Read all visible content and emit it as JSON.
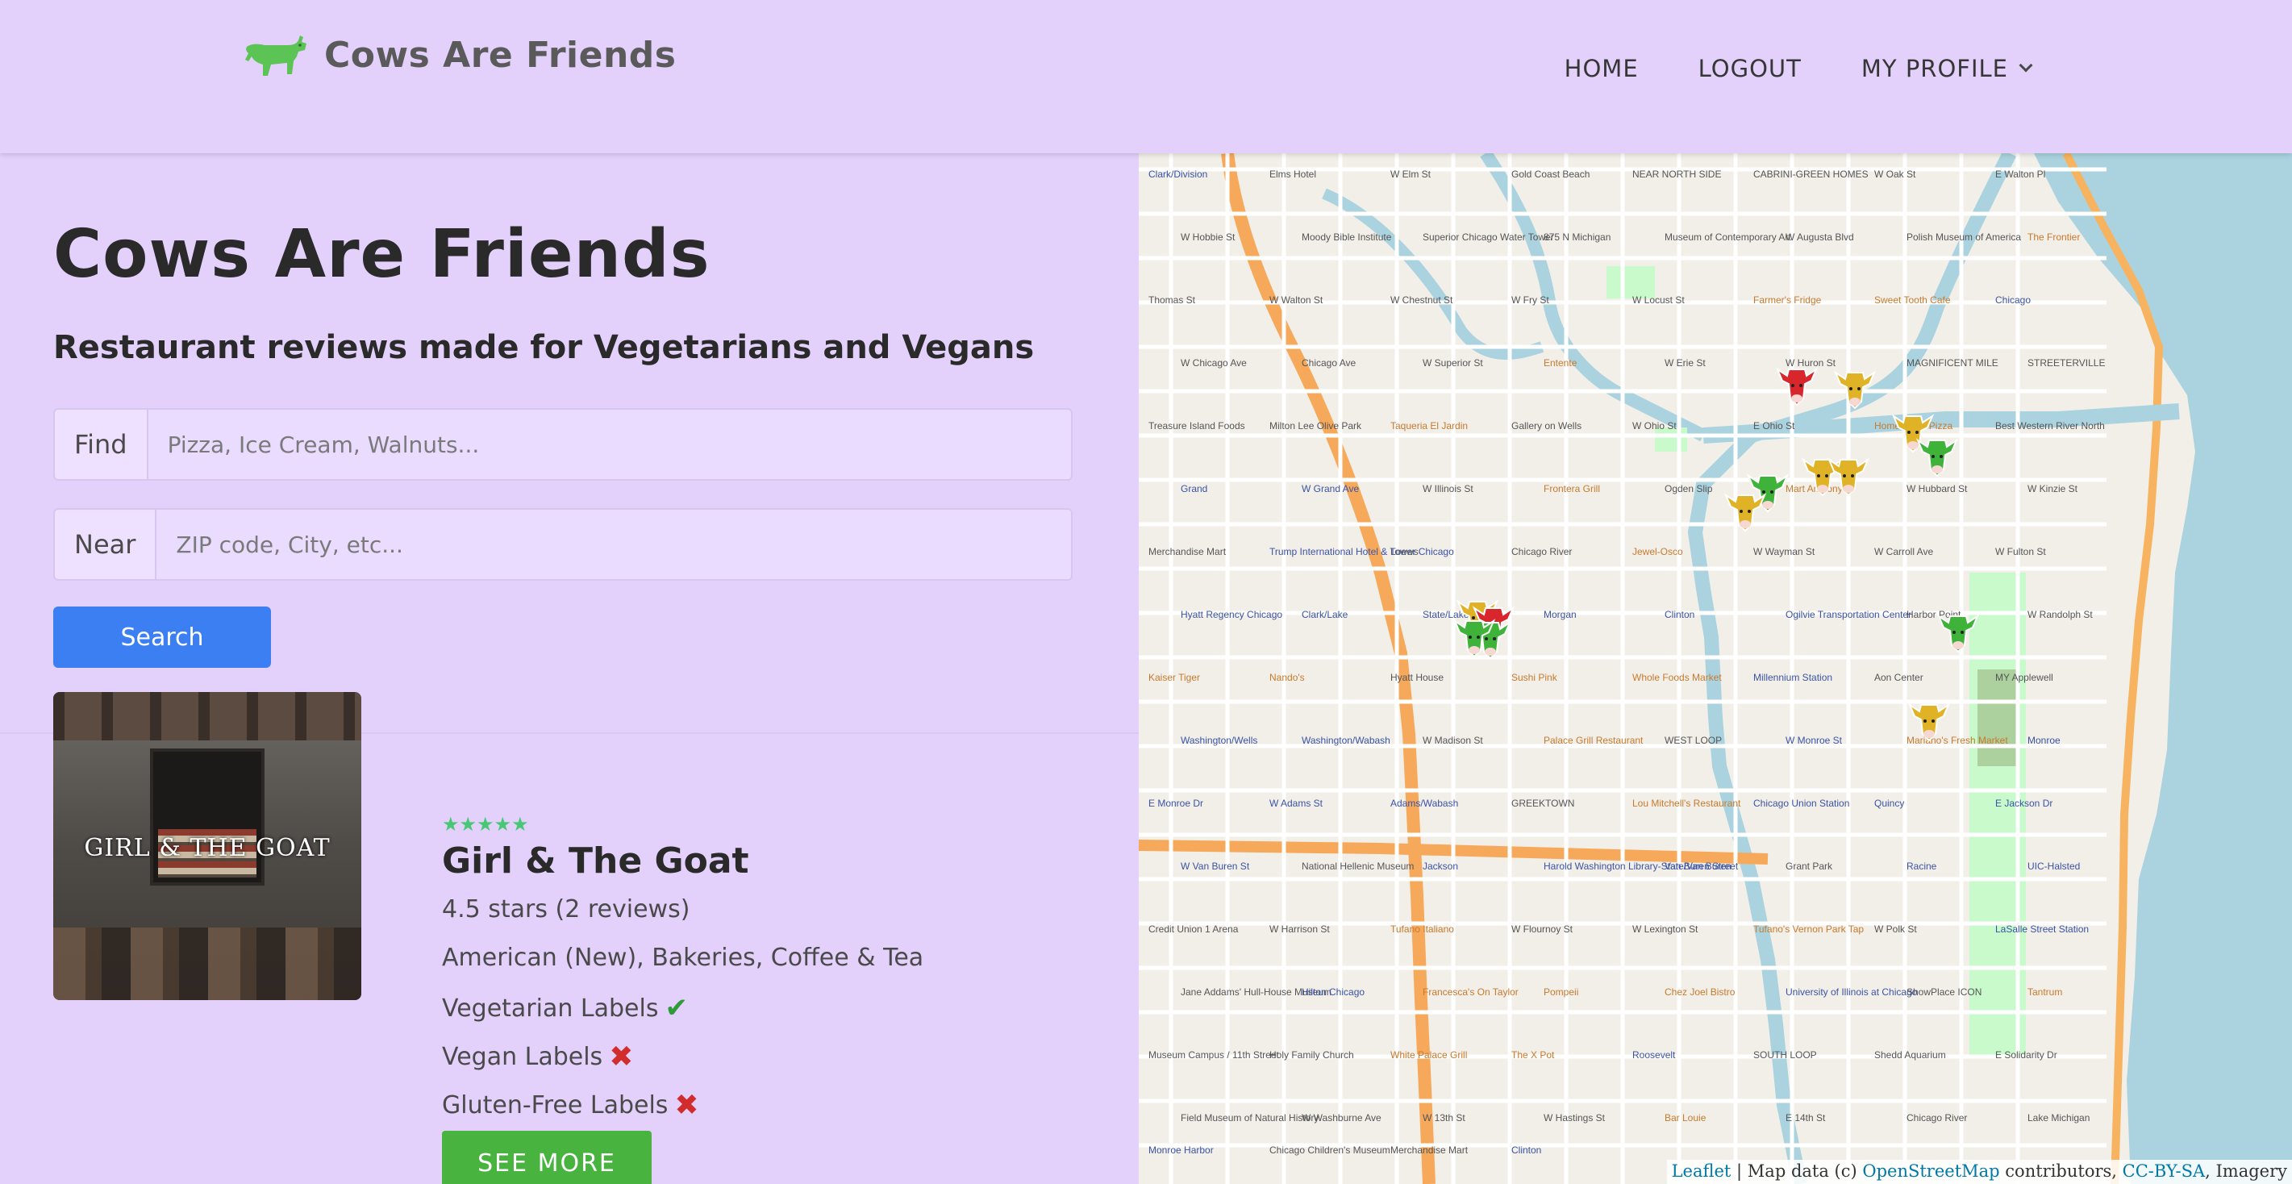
{
  "nav": {
    "brand": "Cows Are Friends",
    "home": "HOME",
    "logout": "LOGOUT",
    "profile": "MY PROFILE"
  },
  "hero": {
    "title": "Cows Are Friends",
    "subtitle": "Restaurant reviews made for Vegetarians and Vegans"
  },
  "search": {
    "find_label": "Find",
    "find_placeholder": "Pizza, Ice Cream, Walnuts...",
    "near_label": "Near",
    "near_placeholder": "ZIP code, City, etc...",
    "button": "Search"
  },
  "result": {
    "image_text_1": "GIRL",
    "image_text_amp": "&",
    "image_text_2": "THE GOAT",
    "stars": "★★★★★",
    "name": "Girl & The Goat",
    "rating": "4.5 stars (2 reviews)",
    "categories": "American (New), Bakeries, Coffee & Tea",
    "veg_label": "Vegetarian Labels",
    "vegan_label": "Vegan Labels",
    "gf_label": "Gluten-Free Labels",
    "veg_icon": "✔",
    "vegan_icon": "✖",
    "gf_icon": "✖",
    "see_more": "SEE MORE",
    "veg": true,
    "vegan": false,
    "gluten_free": false
  },
  "map": {
    "labels": [
      "Clark/Division",
      "Elms Hotel",
      "W Elm St",
      "Gold Coast Beach",
      "NEAR NORTH SIDE",
      "CABRINI-GREEN HOMES",
      "W Oak St",
      "E Walton Pl",
      "W Hobbie St",
      "Moody Bible Institute",
      "Superior Chicago Water Tower",
      "875 N Michigan",
      "Museum of Contemporary Art",
      "W Augusta Blvd",
      "Polish Museum of America",
      "The Frontier",
      "Thomas St",
      "W Walton St",
      "W Chestnut St",
      "W Fry St",
      "W Locust St",
      "Farmer's Fridge",
      "Sweet Tooth Cafe",
      "Chicago",
      "W Chicago Ave",
      "Chicago Ave",
      "W Superior St",
      "Entente",
      "W Erie St",
      "W Huron St",
      "MAGNIFICENT MILE",
      "STREETERVILLE",
      "Treasure Island Foods",
      "Milton Lee Olive Park",
      "Taqueria El Jardin",
      "Gallery on Wells",
      "W Ohio St",
      "E Ohio St",
      "Home Team Pizza",
      "Best Western River North",
      "Grand",
      "W Grand Ave",
      "W Illinois St",
      "Frontera Grill",
      "Ogden Slip",
      "Mart Anthony's",
      "W Hubbard St",
      "W Kinzie St",
      "Merchandise Mart",
      "Trump International Hotel & Tower Chicago",
      "Loews",
      "Chicago River",
      "Jewel-Osco",
      "W Wayman St",
      "W Carroll Ave",
      "W Fulton St",
      "Hyatt Regency Chicago",
      "Clark/Lake",
      "State/Lake",
      "Morgan",
      "Clinton",
      "Ogilvie Transportation Center",
      "Harbor Point",
      "W Randolph St",
      "Kaiser Tiger",
      "Nando's",
      "Hyatt House",
      "Sushi Pink",
      "Whole Foods Market",
      "Millennium Station",
      "Aon Center",
      "MY Applewell",
      "Washington/Wells",
      "Washington/Wabash",
      "W Madison St",
      "Palace Grill Restaurant",
      "WEST LOOP",
      "W Monroe St",
      "Mariano's Fresh Market",
      "Monroe",
      "E Monroe Dr",
      "W Adams St",
      "Adams/Wabash",
      "GREEKTOWN",
      "Lou Mitchell's Restaurant",
      "Chicago Union Station",
      "Quincy",
      "E Jackson Dr",
      "W Van Buren St",
      "National Hellenic Museum",
      "Jackson",
      "Harold Washington Library-State/Van Buren",
      "Van Buren Street",
      "Grant Park",
      "Racine",
      "UIC-Halsted",
      "Credit Union 1 Arena",
      "W Harrison St",
      "Tufano Italiano",
      "W Flournoy St",
      "W Lexington St",
      "Tufano's Vernon Park Tap",
      "W Polk St",
      "LaSalle Street Station",
      "Jane Addams' Hull-House Museum",
      "Hilton Chicago",
      "Francesca's On Taylor",
      "Pompeii",
      "Chez Joel Bistro",
      "University of Illinois at Chicago",
      "ShowPlace ICON",
      "Tantrum",
      "Museum Campus / 11th Street",
      "Holy Family Church",
      "White Palace Grill",
      "The X Pot",
      "Roosevelt",
      "SOUTH LOOP",
      "Shedd Aquarium",
      "E Solidarity Dr",
      "Field Museum of Natural History",
      "W Washburne Ave",
      "W 13th St",
      "W Hastings St",
      "Bar Louie",
      "E 14th St",
      "Chicago River",
      "Lake Michigan",
      "Monroe Harbor",
      "Chicago Children's Museum",
      "Merchandise Mart",
      "Clinton"
    ]
  },
  "attribution": {
    "leaflet": "Leaflet",
    "sep": " | Map data (c) ",
    "osm": "OpenStreetMap",
    "contrib": " contributors, ",
    "cc": "CC-BY-SA",
    "imagery": ", Imagery"
  },
  "colors": {
    "background": "#e3d1fc",
    "search_button": "#3b7ff2",
    "see_more_button": "#48b43f",
    "brand_cow": "#5cc454",
    "marker_green": "#3fb23a",
    "marker_yellow": "#e0b225",
    "marker_red": "#d8262c"
  }
}
